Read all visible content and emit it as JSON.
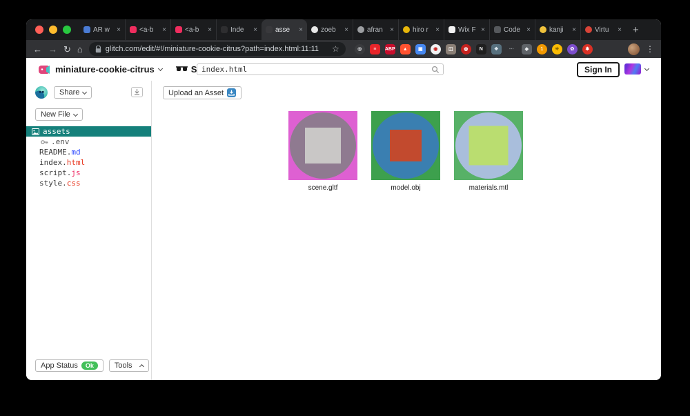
{
  "browser": {
    "glyphs": {
      "close": "×",
      "new_tab": "+",
      "back": "←",
      "forward": "→",
      "reload": "↻",
      "home": "⌂",
      "star": "☆",
      "menu": "⋮"
    },
    "traffic_lights": {
      "close": "#ff5f57",
      "minimize": "#febc2e",
      "maximize": "#28c840"
    },
    "tabs": [
      {
        "title": "AR w",
        "favicon_color": "#4a7bd4",
        "active": false
      },
      {
        "title": "<a-b",
        "favicon_color": "#ef2d5e",
        "active": false
      },
      {
        "title": "<a-b",
        "favicon_color": "#ef2d5e",
        "active": false
      },
      {
        "title": "Inde",
        "favicon_color": "#2e2e30",
        "active": false
      },
      {
        "title": "asse",
        "favicon_color": "#39393c",
        "active": true
      },
      {
        "title": "zoeb",
        "favicon_color": "#e8e8e8",
        "active": false
      },
      {
        "title": "afran",
        "favicon_color": "#9c9ea1",
        "active": false
      },
      {
        "title": "hiro r",
        "favicon_color": "#e8b70a",
        "active": false
      },
      {
        "title": "Wix F",
        "favicon_color": "#f2f2f2",
        "active": false
      },
      {
        "title": "Code",
        "favicon_color": "#55585c",
        "active": false
      },
      {
        "title": "kanji",
        "favicon_color": "#f0c23c",
        "active": false
      },
      {
        "title": "Virtu",
        "favicon_color": "#d94438",
        "active": false
      }
    ],
    "url": "glitch.com/edit/#!/miniature-cookie-citrus?path=index.html:11:11",
    "extensions": [
      {
        "glyph": "◎",
        "bg": "#3a3b3e",
        "fg": "#e8eaed"
      },
      {
        "glyph": "≡",
        "bg": "#e8252a",
        "fg": "#ffffff"
      },
      {
        "glyph": "ABP",
        "bg": "#c70d2c",
        "fg": "#ffffff"
      },
      {
        "glyph": "▲",
        "bg": "#ff5230",
        "fg": "#ffffff"
      },
      {
        "glyph": "▣",
        "bg": "#4688f1",
        "fg": "#ffffff"
      },
      {
        "glyph": "◉",
        "bg": "#f1f3f4",
        "fg": "#c5221f"
      },
      {
        "glyph": "◫",
        "bg": "#8a7f76",
        "fg": "#ffffff"
      },
      {
        "glyph": "◍",
        "bg": "#c5221f",
        "fg": "#ffffff"
      },
      {
        "glyph": "N",
        "bg": "#1f1f1f",
        "fg": "#ffffff"
      },
      {
        "glyph": "❖",
        "bg": "#57707e",
        "fg": "#dfe8ee"
      },
      {
        "glyph": "⋯",
        "bg": "transparent",
        "fg": "#9aa0a6"
      },
      {
        "glyph": "◆",
        "bg": "#5f6368",
        "fg": "#e8eaed"
      },
      {
        "glyph": "1",
        "bg": "#f29900",
        "fg": "#ffffff"
      },
      {
        "glyph": "☀",
        "bg": "#fbbc04",
        "fg": "#7a5a00"
      },
      {
        "glyph": "✿",
        "bg": "#7c4dcc",
        "fg": "#ffffff"
      },
      {
        "glyph": "✱",
        "bg": "#d93025",
        "fg": "#ffffff"
      }
    ]
  },
  "glitch": {
    "project_name": "miniature-cookie-citrus",
    "show_label": "Show",
    "search_value": "index.html",
    "sign_in_label": "Sign In",
    "share_label": "Share",
    "new_file_label": "New File",
    "selected_file_bg": "#15807b",
    "files": [
      {
        "name": "assets",
        "selected": true
      },
      {
        "name": ".env"
      },
      {
        "base": "README.",
        "ext": "md",
        "ext_color": "#2945ff"
      },
      {
        "base": "index.",
        "ext": "html",
        "ext_color": "#e8341c"
      },
      {
        "base": "script.",
        "ext": "js",
        "ext_color": "#ee2560"
      },
      {
        "base": "style.",
        "ext": "css",
        "ext_color": "#e8341c"
      }
    ],
    "app_status_label": "App Status",
    "app_status_value": "Ok",
    "ok_badge_color": "#43c059",
    "tools_label": "Tools",
    "upload_label": "Upload an Asset",
    "upload_icon_color": "#3b88c3",
    "assets": [
      {
        "label": "scene.gltf",
        "bg": "#de60d2",
        "circle": "#8f7a90",
        "diamond": null,
        "square": "#c9c7c6"
      },
      {
        "label": "model.obj",
        "bg": "#3da04d",
        "circle": "#3a7fb1",
        "diamond": "#3a7fb1",
        "square": "#c24a2e"
      },
      {
        "label": "materials.mtl",
        "bg": "#57b167",
        "circle": "#a9bedc",
        "diamond": "#a9bedc",
        "square": "#badd70"
      }
    ]
  }
}
